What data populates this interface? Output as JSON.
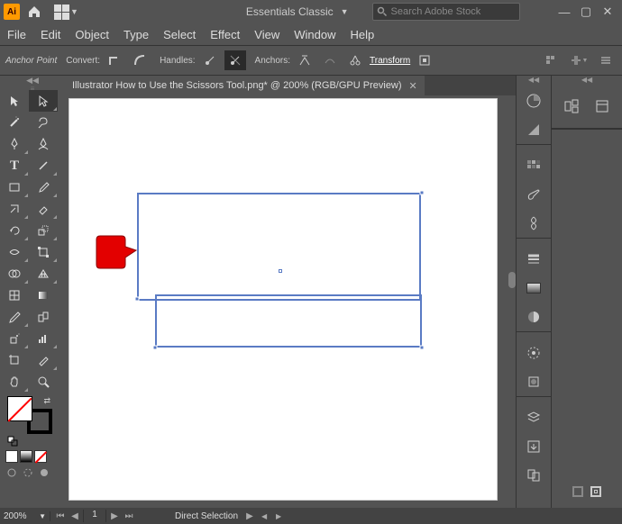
{
  "titlebar": {
    "logo_text": "Ai",
    "workspace_label": "Essentials Classic",
    "stock_placeholder": "Search Adobe Stock"
  },
  "menus": [
    "File",
    "Edit",
    "Object",
    "Type",
    "Select",
    "Effect",
    "View",
    "Window",
    "Help"
  ],
  "control": {
    "anchor_point": "Anchor Point",
    "convert": "Convert:",
    "handles": "Handles:",
    "anchors": "Anchors:",
    "transform": "Transform"
  },
  "doc": {
    "tab_title": "Illustrator How to Use the Scissors Tool.png* @ 200% (RGB/GPU Preview)"
  },
  "status": {
    "zoom": "200%",
    "page": "1",
    "tool_name": "Direct Selection"
  }
}
